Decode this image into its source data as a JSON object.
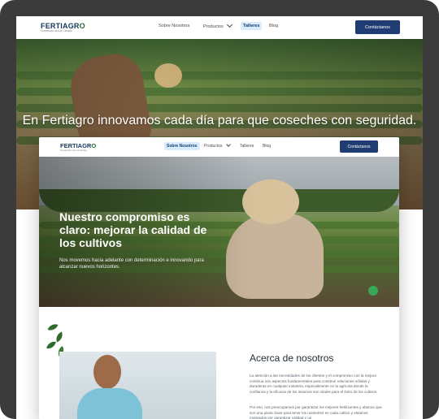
{
  "back_page": {
    "brand": {
      "name_part1": "FERTIAGR",
      "name_part2": "O",
      "tagline": "Creciendo con el Campo"
    },
    "nav": {
      "items": [
        "Sobre Nosotros",
        "Productos",
        "Talleres",
        "Blog"
      ],
      "active_index": 2,
      "cta": "Contáctanos"
    },
    "hero": {
      "title": "En Fertiagro innovamos cada día para que coseches con seguridad."
    }
  },
  "front_page": {
    "brand": {
      "name_part1": "FERTIAGR",
      "name_part2": "O",
      "tagline": "Creciendo con el Campo"
    },
    "nav": {
      "items": [
        "Sobre Nosotros",
        "Productos",
        "Talleres",
        "Blog"
      ],
      "active_index": 0,
      "cta": "Contáctanos"
    },
    "hero": {
      "title": "Nuestro compromiso es claro: mejorar la calidad de los cultivos",
      "subtitle": "Nos movemos hacia adelante con determinación e innovando para alcanzar nuevos horizontes."
    },
    "about": {
      "title": "Acerca de nosotros",
      "p1": "La atención a las necesidades de los clientes y el compromiso con la mejora continua son aspectos fundamentales para construir relaciones sólidas y duraderas en cualquier industria, especialmente en la agrícola donde la confianza y la eficacia de los insumos son vitales para el éxito de los cultivos.",
      "p2": "Por eso, nos preocupamos por garantizar los mejores fertilizantes y abonos que son una pieza clave para tener los nutrientes en cada cultivo y estamos motivados por garantizar calidad y un"
    }
  },
  "colors": {
    "frame": "#3b3b3b",
    "brand_blue": "#17365d",
    "brand_green": "#1f6e2f",
    "cta_blue": "#1f3d73",
    "active_tab_bg": "#d7ecff",
    "chat_green": "#3aa657"
  },
  "icons": {
    "productos_dropdown": "chevron-down-icon",
    "chat": "chat-bubble-icon",
    "decorative_leaves": "coffee-leaf-icon"
  }
}
